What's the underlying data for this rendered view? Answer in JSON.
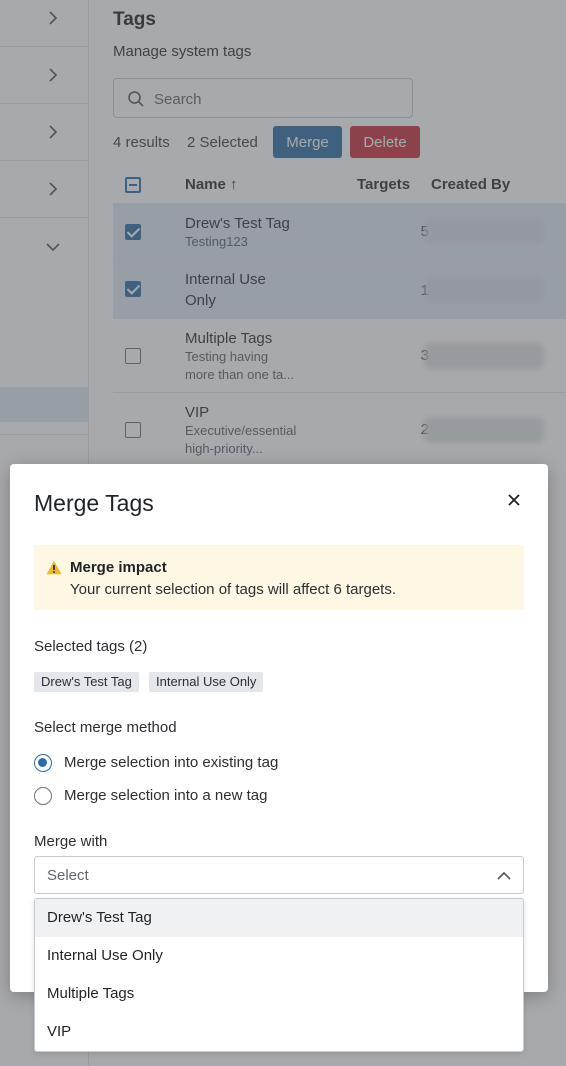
{
  "page": {
    "title": "Tags",
    "subtitle": "Manage system tags",
    "search_placeholder": "Search",
    "results": "4 results",
    "selected": "2 Selected",
    "merge_label": "Merge",
    "delete_label": "Delete"
  },
  "sidebar": {
    "items": [
      {
        "icon": "chevron-right-icon"
      },
      {
        "icon": "chevron-right-icon"
      },
      {
        "icon": "chevron-right-icon"
      },
      {
        "icon": "chevron-right-icon"
      },
      {
        "icon": "chevron-down-icon"
      }
    ]
  },
  "table": {
    "headers": {
      "name": "Name",
      "sort": "↑",
      "targets": "Targets",
      "created_by": "Created By"
    },
    "rows": [
      {
        "name": "Drew's Test Tag",
        "desc": "Testing123",
        "targets": "5",
        "checked": true
      },
      {
        "name": "Internal Use Only",
        "name_line1": "Internal Use",
        "name_line2": "Only",
        "desc": "",
        "targets": "1",
        "checked": true
      },
      {
        "name": "Multiple Tags",
        "desc_line1": "Testing having",
        "desc_line2": "more than one ta...",
        "targets": "3",
        "checked": false
      },
      {
        "name": "VIP",
        "desc_line1": "Executive/essential",
        "desc_line2": "high-priority...",
        "targets": "2",
        "checked": false
      }
    ]
  },
  "modal": {
    "title": "Merge Tags",
    "close_icon": "close-icon",
    "callout": {
      "icon": "warning-icon",
      "title": "Merge impact",
      "body": "Your current selection of tags will affect 6 targets."
    },
    "selected_tags_label": "Selected tags (2)",
    "selected_tags": [
      "Drew's Test Tag",
      "Internal Use Only"
    ],
    "merge_method_label": "Select merge method",
    "merge_methods": [
      {
        "label": "Merge selection into existing tag",
        "selected": true
      },
      {
        "label": "Merge selection into a new tag",
        "selected": false
      }
    ],
    "merge_with_label": "Merge with",
    "merge_with_placeholder": "Select",
    "options": [
      "Drew's Test Tag",
      "Internal Use Only",
      "Multiple Tags",
      "VIP"
    ],
    "highlighted_option": "Drew's Test Tag"
  },
  "colors": {
    "primary": "#2f6ea5",
    "danger": "#c7303c",
    "selected_row": "#dfe9f3",
    "callout_bg": "#fdf7e3",
    "warning": "#e8b931"
  }
}
